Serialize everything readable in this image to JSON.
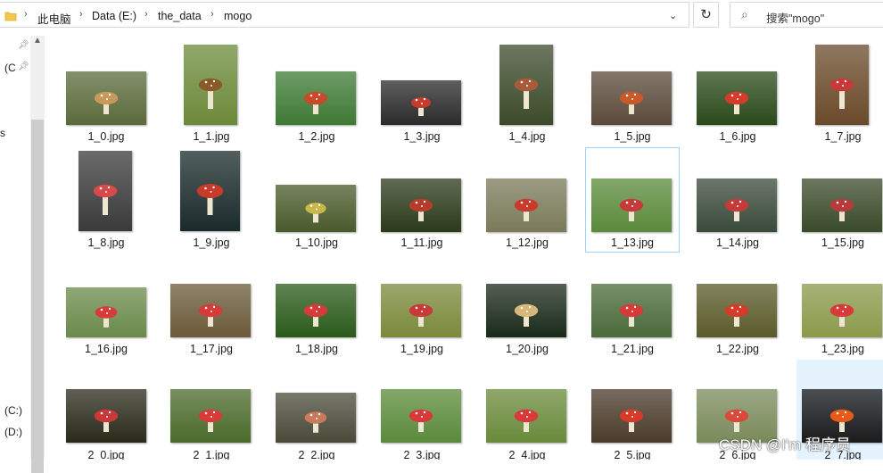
{
  "address_bar": {
    "breadcrumbs": [
      "此电脑",
      "Data (E:)",
      "the_data",
      "mogo"
    ]
  },
  "search": {
    "placeholder": "搜索\"mogo\""
  },
  "nav_pane": {
    "items": [
      "(C",
      "s",
      "(C:)",
      "(D:)"
    ]
  },
  "files": [
    {
      "name": "1_0.jpg",
      "colors": [
        "#5b6a3a",
        "#c79a5b"
      ]
    },
    {
      "name": "1_1.jpg",
      "colors": [
        "#6c8a3a",
        "#8a5a2a"
      ]
    },
    {
      "name": "1_2.jpg",
      "colors": [
        "#3e7a34",
        "#c84a2a"
      ]
    },
    {
      "name": "1_3.jpg",
      "colors": [
        "#2a2a2a",
        "#c83a2a"
      ]
    },
    {
      "name": "1_4.jpg",
      "colors": [
        "#3c4a2a",
        "#a85a3a"
      ]
    },
    {
      "name": "1_5.jpg",
      "colors": [
        "#5a4a3a",
        "#c85a2a"
      ]
    },
    {
      "name": "1_6.jpg",
      "colors": [
        "#2a4a1a",
        "#d83a2a"
      ]
    },
    {
      "name": "1_7.jpg",
      "colors": [
        "#6a4a2a",
        "#c83a3a"
      ]
    },
    {
      "name": "1_8.jpg",
      "colors": [
        "#3a3a3a",
        "#d84a4a"
      ]
    },
    {
      "name": "1_9.jpg",
      "colors": [
        "#1a2a2a",
        "#c83a2a"
      ]
    },
    {
      "name": "1_10.jpg",
      "colors": [
        "#4a5a2a",
        "#c8b84a"
      ]
    },
    {
      "name": "1_11.jpg",
      "colors": [
        "#2a3a1a",
        "#b83a2a"
      ]
    },
    {
      "name": "1_12.jpg",
      "colors": [
        "#7a7a5a",
        "#c83a2a"
      ]
    },
    {
      "name": "1_13.jpg",
      "colors": [
        "#5a8a3a",
        "#c83a3a"
      ]
    },
    {
      "name": "1_14.jpg",
      "colors": [
        "#3a4a3a",
        "#c83a3a"
      ]
    },
    {
      "name": "1_15.jpg",
      "colors": [
        "#3a4a2a",
        "#b83a3a"
      ]
    },
    {
      "name": "1_16.jpg",
      "colors": [
        "#6a8a4a",
        "#d83a3a"
      ]
    },
    {
      "name": "1_17.jpg",
      "colors": [
        "#6a5a3a",
        "#d83a3a"
      ]
    },
    {
      "name": "1_18.jpg",
      "colors": [
        "#2a5a1a",
        "#d83a3a"
      ]
    },
    {
      "name": "1_19.jpg",
      "colors": [
        "#7a8a3a",
        "#c83a3a"
      ]
    },
    {
      "name": "1_20.jpg",
      "colors": [
        "#1a2a1a",
        "#d8b87a"
      ]
    },
    {
      "name": "1_21.jpg",
      "colors": [
        "#4a6a3a",
        "#d83a3a"
      ]
    },
    {
      "name": "1_22.jpg",
      "colors": [
        "#5a5a2a",
        "#d83a2a"
      ]
    },
    {
      "name": "1_23.jpg",
      "colors": [
        "#8a9a4a",
        "#d83a3a"
      ]
    },
    {
      "name": "2_0.jpg",
      "colors": [
        "#2a2a1a",
        "#c83a3a"
      ]
    },
    {
      "name": "2_1.jpg",
      "colors": [
        "#4a6a2a",
        "#d83a3a"
      ]
    },
    {
      "name": "2_2.jpg",
      "colors": [
        "#4a4a3a",
        "#c87a5a"
      ]
    },
    {
      "name": "2_3.jpg",
      "colors": [
        "#5a8a3a",
        "#d83a3a"
      ]
    },
    {
      "name": "2_4.jpg",
      "colors": [
        "#6a8a3a",
        "#d83a3a"
      ]
    },
    {
      "name": "2_5.jpg",
      "colors": [
        "#4a3a2a",
        "#d83a2a"
      ]
    },
    {
      "name": "2_6.jpg",
      "colors": [
        "#7a8a5a",
        "#d84a3a"
      ]
    },
    {
      "name": "2_7.jpg",
      "colors": [
        "#1a1a1a",
        "#e85a1a"
      ]
    }
  ],
  "watermark": "CSDN @I'm 程序员"
}
